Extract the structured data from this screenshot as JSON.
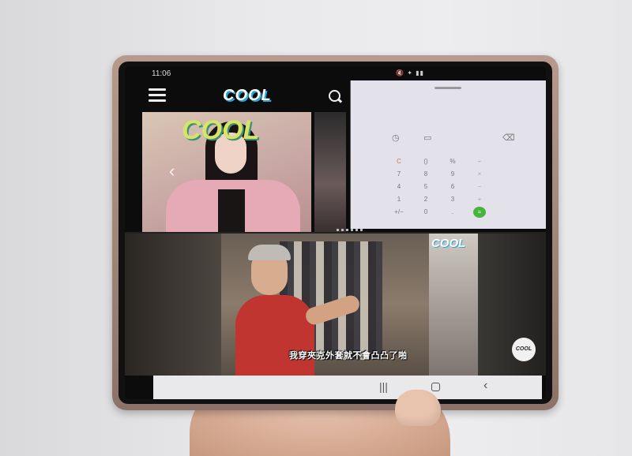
{
  "status_bar": {
    "time": "11:06",
    "icons": "🔇 ✦ ▮▮"
  },
  "news_app": {
    "logo": "COOL",
    "magazine_cover_title": "COOL",
    "menu_icon": "hamburger-menu-icon",
    "search_icon": "search-icon",
    "prev_arrow": "‹",
    "next_arrow": "›"
  },
  "calculator": {
    "history_icon": "◷",
    "ruler_icon": "▭",
    "backspace_icon": "⌫",
    "keys": [
      [
        "C",
        "()",
        "%",
        "÷"
      ],
      [
        "7",
        "8",
        "9",
        "×"
      ],
      [
        "4",
        "5",
        "6",
        "−"
      ],
      [
        "1",
        "2",
        "3",
        "+"
      ],
      [
        "+/−",
        "0",
        ".",
        "="
      ]
    ]
  },
  "video": {
    "logo": "COOL",
    "subtitle": "我穿夾克外套就不會凸凸了啪",
    "badge": "COOL"
  },
  "navigation": {
    "recents": "|||",
    "back": "‹"
  },
  "colors": {
    "accent_green": "#47b53d",
    "logo_shadow": "#2aa7d8"
  }
}
